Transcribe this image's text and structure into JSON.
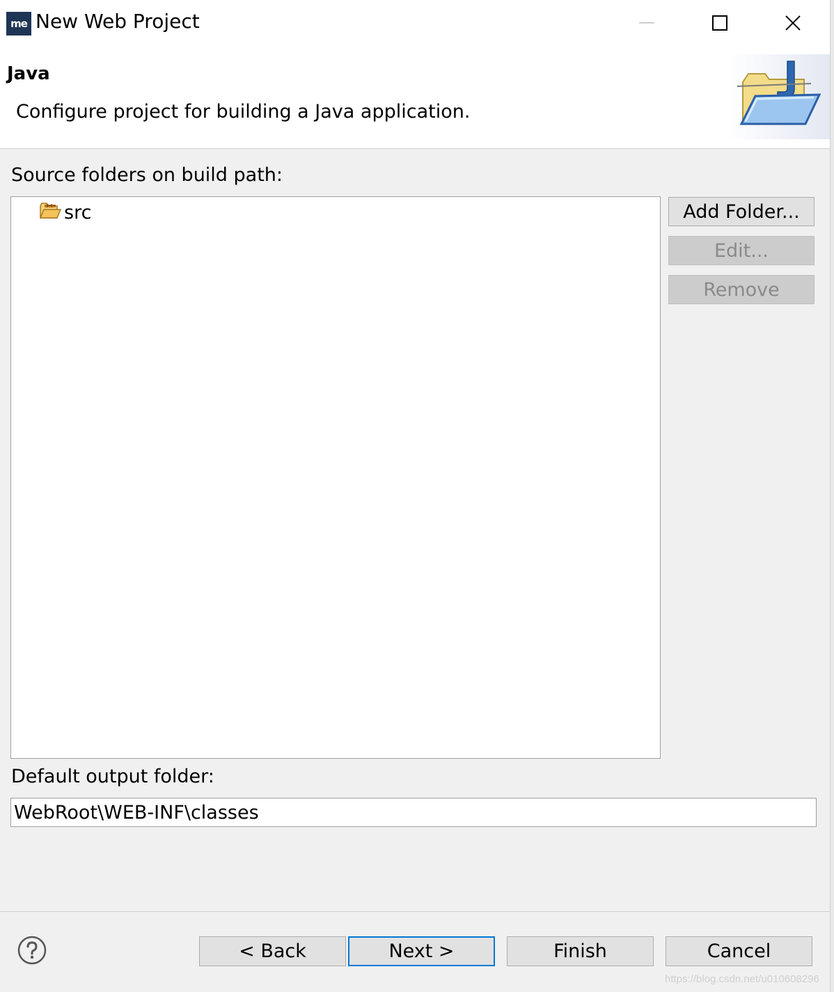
{
  "window": {
    "title": "New Web Project",
    "app_icon_text": "me"
  },
  "banner": {
    "title": "Java",
    "description": "Configure project for building a Java application.",
    "art_icon": "java-folder-icon"
  },
  "source": {
    "label": "Source folders on build path:",
    "items": [
      {
        "label": "src",
        "icon": "source-folder-icon"
      }
    ],
    "buttons": {
      "add_folder": "Add Folder...",
      "edit": "Edit...",
      "remove": "Remove"
    }
  },
  "output": {
    "label": "Default output folder:",
    "value": "WebRoot\\WEB-INF\\classes"
  },
  "footer": {
    "back": "< Back",
    "next": "Next >",
    "finish": "Finish",
    "cancel": "Cancel",
    "help_icon": "help-icon"
  },
  "watermark": "https://blog.csdn.net/u010608296",
  "colors": {
    "dialog_bg": "#f0f0f0",
    "button_bg": "#e1e1e1",
    "default_button_border": "#0078d7",
    "app_icon_bg": "#1f3556"
  }
}
